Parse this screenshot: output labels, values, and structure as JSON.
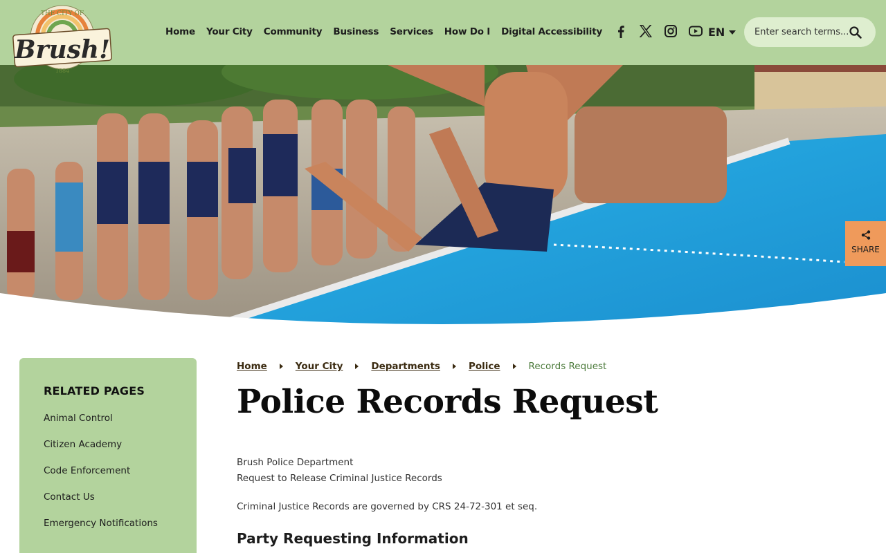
{
  "header": {
    "logo": {
      "top_text": "THE CITY OF",
      "name": "Brush!",
      "year": "1884"
    },
    "nav": [
      "Home",
      "Your City",
      "Community",
      "Business",
      "Services",
      "How Do I",
      "Digital Accessibility"
    ],
    "social_icons": [
      "facebook-icon",
      "x-icon",
      "instagram-icon",
      "youtube-icon"
    ],
    "language": "EN",
    "search_placeholder": "Enter search terms..."
  },
  "share": {
    "label": "SHARE"
  },
  "sidebar": {
    "title": "RELATED PAGES",
    "items": [
      "Animal Control",
      "Citizen Academy",
      "Code Enforcement",
      "Contact Us",
      "Emergency Notifications"
    ]
  },
  "breadcrumb": {
    "links": [
      "Home",
      "Your City",
      "Departments",
      "Police"
    ],
    "current": "Records Request"
  },
  "main": {
    "title": "Police Records Request",
    "dept": "Brush Police Department",
    "subtitle": "Request to Release Criminal Justice Records",
    "governed": "Criminal Justice Records are governed by CRS 24-72-301 et seq.",
    "section_heading": "Party Requesting Information"
  },
  "colors": {
    "header_bg": "#b3d39d",
    "share_bg": "#ef9a5b",
    "pool": "#1ea9e0"
  }
}
